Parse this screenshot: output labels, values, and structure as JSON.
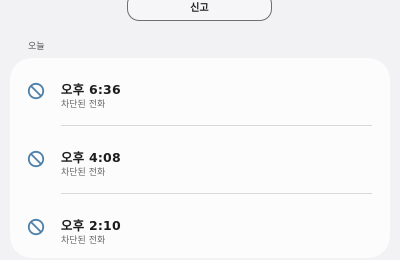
{
  "header": {
    "report_label": "신고"
  },
  "section": {
    "label": "오늘"
  },
  "calls": [
    {
      "time": "오후 6:36",
      "status": "차단된 전화",
      "icon": "block-icon"
    },
    {
      "time": "오후 4:08",
      "status": "차단된 전화",
      "icon": "block-icon"
    },
    {
      "time": "오후 2:10",
      "status": "차단된 전화",
      "icon": "block-icon"
    }
  ],
  "colors": {
    "background": "#f2f2f5",
    "card": "#fcfcfd",
    "block_icon": "#4d7fa8"
  }
}
